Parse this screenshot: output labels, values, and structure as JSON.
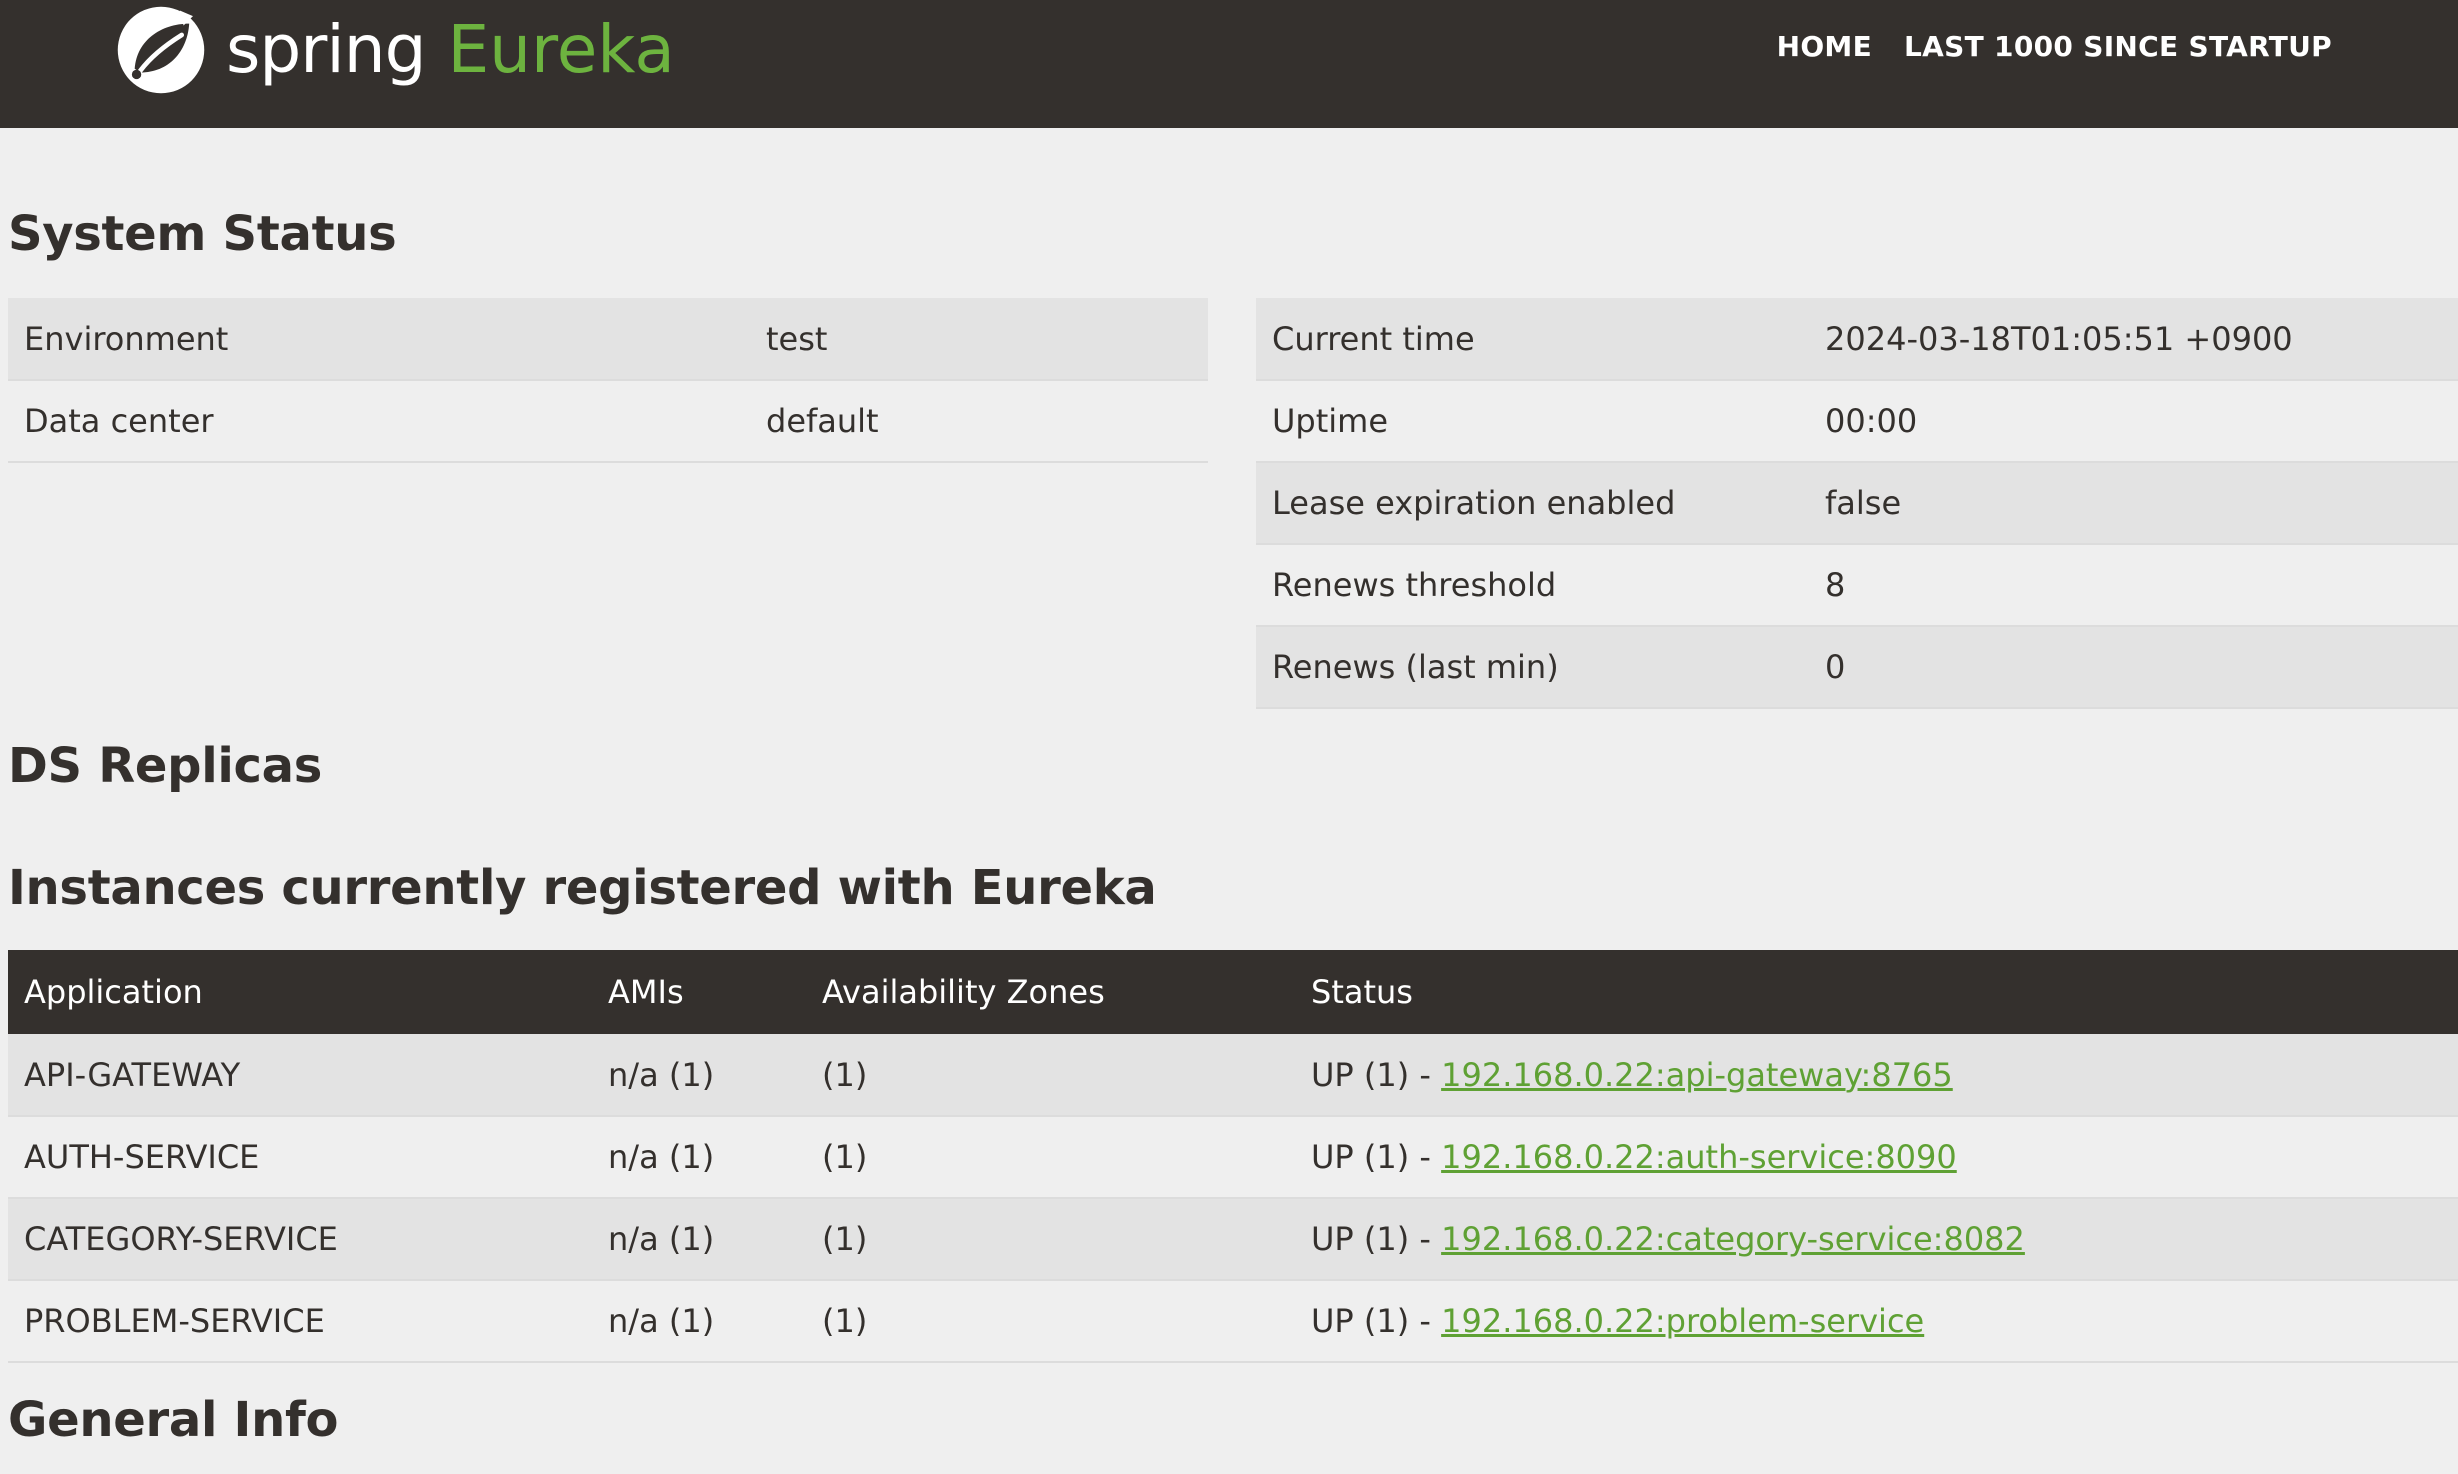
{
  "header": {
    "brand_spring": "spring",
    "brand_eureka": "Eureka",
    "nav": [
      {
        "label": "HOME"
      },
      {
        "label": "LAST 1000 SINCE STARTUP"
      }
    ],
    "colors": {
      "bar": "#34302d",
      "accent": "#6db33f"
    }
  },
  "system_status": {
    "title": "System Status",
    "left": [
      {
        "key": "Environment",
        "value": "test"
      },
      {
        "key": "Data center",
        "value": "default"
      }
    ],
    "right": [
      {
        "key": "Current time",
        "value": "2024-03-18T01:05:51 +0900"
      },
      {
        "key": "Uptime",
        "value": "00:00"
      },
      {
        "key": "Lease expiration enabled",
        "value": "false"
      },
      {
        "key": "Renews threshold",
        "value": "8"
      },
      {
        "key": "Renews (last min)",
        "value": "0"
      }
    ]
  },
  "ds_replicas": {
    "title": "DS Replicas"
  },
  "instances": {
    "title": "Instances currently registered with Eureka",
    "columns": [
      "Application",
      "AMIs",
      "Availability Zones",
      "Status"
    ],
    "rows": [
      {
        "application": "API-GATEWAY",
        "amis": "n/a (1)",
        "zones": "(1)",
        "status_prefix": "UP (1) - ",
        "link": "192.168.0.22:api-gateway:8765"
      },
      {
        "application": "AUTH-SERVICE",
        "amis": "n/a (1)",
        "zones": "(1)",
        "status_prefix": "UP (1) - ",
        "link": "192.168.0.22:auth-service:8090"
      },
      {
        "application": "CATEGORY-SERVICE",
        "amis": "n/a (1)",
        "zones": "(1)",
        "status_prefix": "UP (1) - ",
        "link": "192.168.0.22:category-service:8082"
      },
      {
        "application": "PROBLEM-SERVICE",
        "amis": "n/a (1)",
        "zones": "(1)",
        "status_prefix": "UP (1) - ",
        "link": "192.168.0.22:problem-service"
      }
    ]
  },
  "general_info": {
    "title": "General Info"
  }
}
